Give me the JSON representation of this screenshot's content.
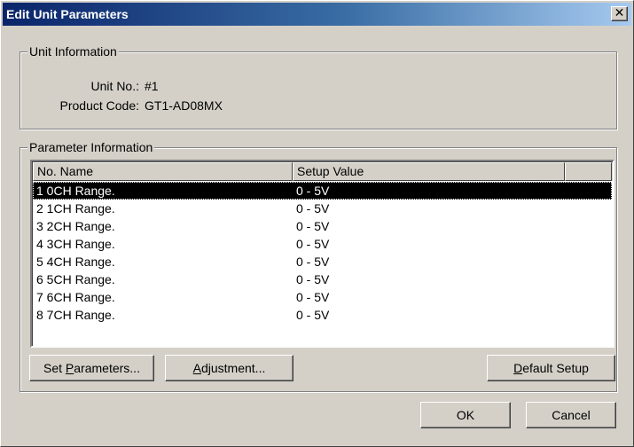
{
  "window": {
    "title": "Edit Unit Parameters",
    "close_glyph": "✕"
  },
  "unit_info": {
    "group_label": "Unit Information",
    "unit_no_label": "Unit No.:",
    "unit_no_value": "#1",
    "product_code_label": "Product Code:",
    "product_code_value": "GT1-AD08MX"
  },
  "param_info": {
    "group_label": "Parameter Information",
    "columns": [
      "No. Name",
      "Setup Value",
      ""
    ],
    "rows": [
      {
        "name": "1  0CH Range.",
        "value": "0 - 5V",
        "selected": true
      },
      {
        "name": "2  1CH Range.",
        "value": "0 - 5V"
      },
      {
        "name": "3  2CH Range.",
        "value": "0 - 5V"
      },
      {
        "name": "4  3CH Range.",
        "value": "0 - 5V"
      },
      {
        "name": "5  4CH Range.",
        "value": "0 - 5V"
      },
      {
        "name": "6  5CH Range.",
        "value": "0 - 5V"
      },
      {
        "name": "7  6CH Range.",
        "value": "0 - 5V"
      },
      {
        "name": "8  7CH Range.",
        "value": "0 - 5V"
      }
    ],
    "buttons": {
      "set_parameters": {
        "pre": "Set ",
        "key": "P",
        "post": "arameters..."
      },
      "adjustment": {
        "pre": "",
        "key": "A",
        "post": "djustment..."
      },
      "default_setup": {
        "pre": "",
        "key": "D",
        "post": "efault Setup"
      }
    }
  },
  "footer": {
    "ok": "OK",
    "cancel": "Cancel"
  },
  "colors": {
    "title_active": "#0a246a",
    "face": "#d4d0c8",
    "selection": "#000000"
  }
}
